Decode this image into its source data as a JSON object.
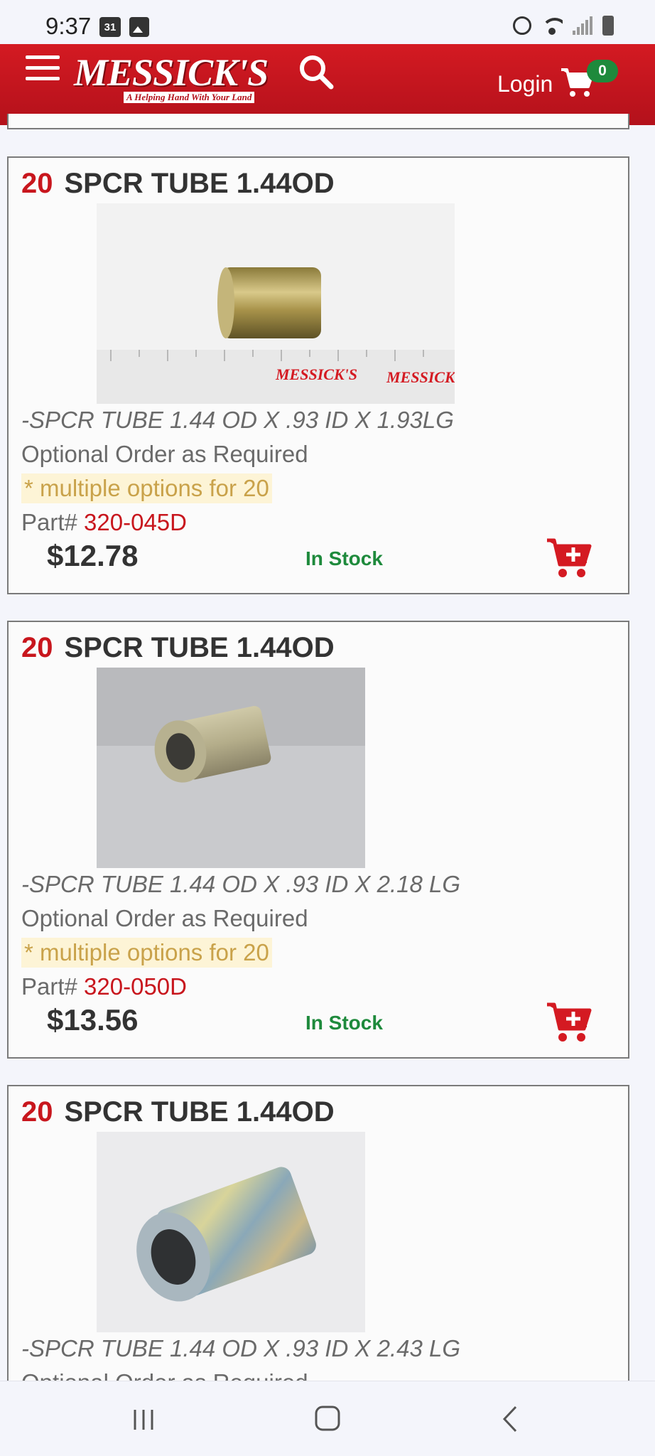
{
  "status_bar": {
    "time": "9:37",
    "calendar_day": "31",
    "icons": [
      "calendar-icon",
      "image-icon",
      "alarm-icon",
      "wifi-icon",
      "signal-icon",
      "battery-icon"
    ]
  },
  "header": {
    "brand": "MESSICK'S",
    "tagline": "A Helping Hand With Your Land",
    "login_label": "Login",
    "cart_count": "0",
    "colors": {
      "header_red": "#c8161d",
      "badge_green": "#1e8a3c"
    }
  },
  "products": [
    {
      "qty": "20",
      "title": "SPCR TUBE 1.44OD",
      "image_alt": "Spacer tube beside ruler",
      "ruler_brand": "MESSICK'S",
      "description": "-SPCR TUBE 1.44 OD X .93 ID X 1.93LG",
      "order_note": "Optional Order as Required",
      "multi_note": "* multiple options for 20",
      "part_label": "Part#",
      "part_number": "320-045D",
      "price": "$12.78",
      "stock": "In Stock"
    },
    {
      "qty": "20",
      "title": "SPCR TUBE 1.44OD",
      "image_alt": "Spacer tube on grey surface",
      "description": "-SPCR TUBE 1.44 OD X .93 ID X 2.18 LG",
      "order_note": "Optional Order as Required",
      "multi_note": "* multiple options for 20",
      "part_label": "Part#",
      "part_number": "320-050D",
      "price": "$13.56",
      "stock": "In Stock"
    },
    {
      "qty": "20",
      "title": "SPCR TUBE 1.44OD",
      "image_alt": "Zinc plated spacer tube",
      "description": "-SPCR TUBE 1.44 OD X .93 ID X 2.43 LG",
      "order_note": "Optional Order as Required"
    }
  ],
  "nav": [
    "recent-apps",
    "home",
    "back"
  ]
}
